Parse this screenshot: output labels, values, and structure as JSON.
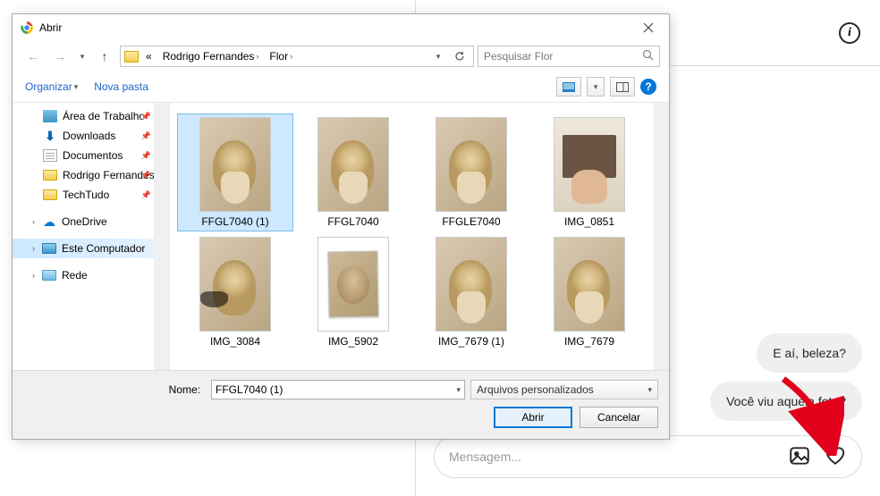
{
  "instagram": {
    "info_glyph": "i",
    "messages": [
      "E aí, beleza?",
      "Você viu aquela foto?"
    ],
    "compose_placeholder": "Mensagem..."
  },
  "dialog": {
    "title": "Abrir",
    "path": {
      "root_label": "«",
      "seg1": "Rodrigo Fernandes",
      "seg2": "Flor"
    },
    "search_placeholder": "Pesquisar Flor",
    "toolbar": {
      "organize": "Organizar",
      "new_folder": "Nova pasta",
      "help": "?"
    },
    "tree": {
      "desktop": "Área de Trabalho",
      "downloads": "Downloads",
      "documents": "Documentos",
      "folder_rf": "Rodrigo Fernandes",
      "folder_tt": "TechTudo",
      "onedrive": "OneDrive",
      "this_pc": "Este Computador",
      "network": "Rede"
    },
    "files": [
      {
        "name": "FFGL7040 (1)"
      },
      {
        "name": "FFGL7040"
      },
      {
        "name": "FFGLE7040"
      },
      {
        "name": "IMG_0851"
      },
      {
        "name": "IMG_3084"
      },
      {
        "name": "IMG_5902"
      },
      {
        "name": "IMG_7679 (1)"
      },
      {
        "name": "IMG_7679"
      }
    ],
    "footer": {
      "name_label": "Nome:",
      "name_value": "FFGL7040 (1)",
      "filter_label": "Arquivos personalizados",
      "open": "Abrir",
      "cancel": "Cancelar"
    }
  }
}
